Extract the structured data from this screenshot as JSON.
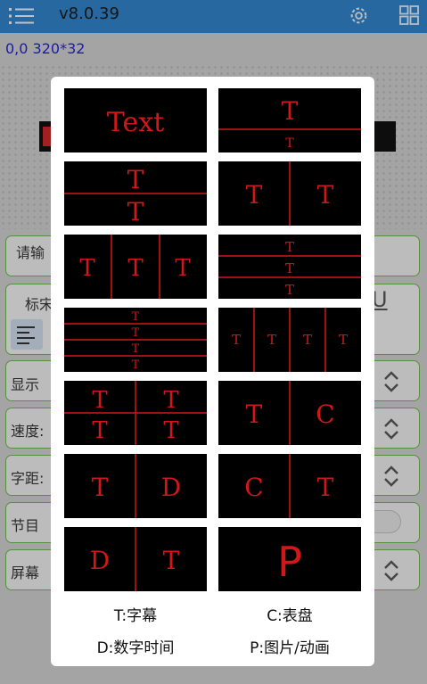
{
  "app": {
    "version": "v8.0.39"
  },
  "screen": {
    "coord_readout": "0,0 320*32"
  },
  "background_form": {
    "input_placeholder_prefix": "请输",
    "font_label_prefix": "标宋",
    "underline_glyph": "U",
    "display_label_prefix": "显示",
    "speed_label_prefix": "速度:",
    "spacing_label_prefix": "字距:",
    "program_label_prefix": "节目",
    "screen_label_prefix": "屏幕"
  },
  "layout_dialog": {
    "text_glyph": "T",
    "clock_glyph": "C",
    "digital_glyph": "D",
    "picture_glyph": "P",
    "tile_sample_text": "Text",
    "legend": {
      "text": "T:字幕",
      "clock": "C:表盘",
      "digital_time": "D:数字时间",
      "picture": "P:图片/动画"
    }
  },
  "colors": {
    "accent": "#2f7fc2",
    "led_red": "#d01818",
    "led_bg": "#000000",
    "border_green": "#6ab04c"
  }
}
